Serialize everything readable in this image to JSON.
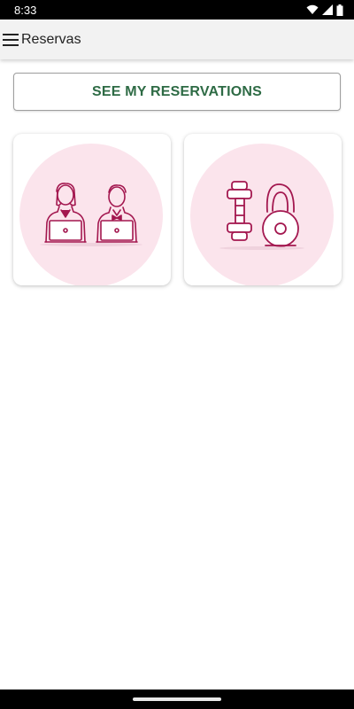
{
  "status_bar": {
    "time": "8:33",
    "icons": [
      "wifi-icon",
      "signal-icon",
      "battery-icon"
    ]
  },
  "app_bar": {
    "title": "Reservas",
    "menu_icon": "hamburger-menu-icon"
  },
  "main": {
    "reservations_button_label": "SEE MY RESERVATIONS",
    "cards": [
      {
        "icon": "coworking-people-laptops-illustration"
      },
      {
        "icon": "dumbbell-kettlebell-illustration"
      }
    ]
  },
  "colors": {
    "accent_green": "#2e6b45",
    "illustration_circle": "#fbe4ec",
    "illustration_stroke": "#a3174f"
  }
}
